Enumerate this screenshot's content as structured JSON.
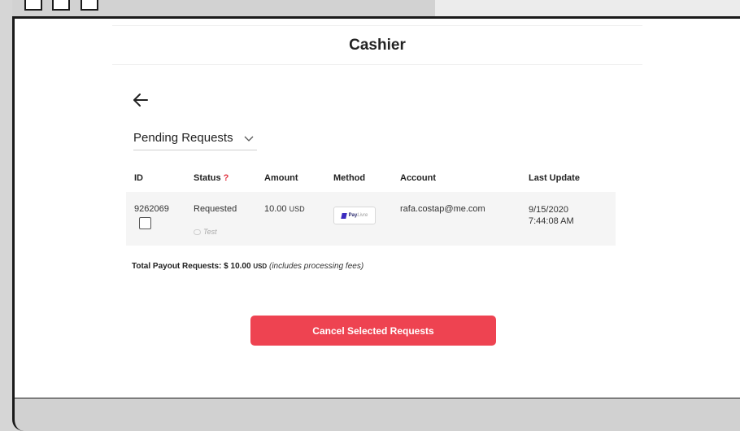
{
  "page": {
    "title": "Cashier"
  },
  "filter": {
    "selected": "Pending Requests"
  },
  "table": {
    "headers": {
      "id": "ID",
      "status": "Status",
      "status_help": "?",
      "amount": "Amount",
      "method": "Method",
      "account": "Account",
      "last_update": "Last Update"
    },
    "rows": [
      {
        "id": "9262069",
        "status": "Requested",
        "note": "Test",
        "amount": "10.00",
        "currency": "USD",
        "method": {
          "brand": "Pay",
          "brand_suffix": "Livre"
        },
        "account": "rafa.costap@me.com",
        "last_update_date": "9/15/2020",
        "last_update_time": "7:44:08 AM"
      }
    ]
  },
  "summary": {
    "label": "Total Payout Requests: $ 10.00",
    "currency": "USD",
    "fees_note": "(includes processing fees)"
  },
  "actions": {
    "cancel_label": "Cancel Selected Requests"
  },
  "colors": {
    "accent": "#ee4351",
    "help": "#e2323f",
    "row_bg": "#f5f5f5"
  }
}
